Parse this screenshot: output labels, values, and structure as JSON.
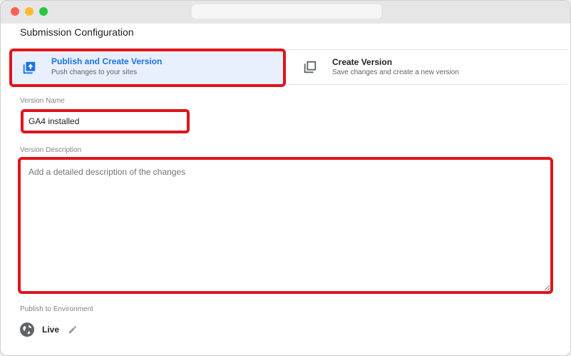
{
  "panel": {
    "title": "Submission Configuration"
  },
  "options": [
    {
      "title": "Publish and Create Version",
      "subtitle": "Push changes to your sites",
      "selected": true,
      "icon": "publish-icon"
    },
    {
      "title": "Create Version",
      "subtitle": "Save changes and create a new version",
      "selected": false,
      "icon": "copy-icon"
    }
  ],
  "version_name": {
    "label": "Version Name",
    "value": "GA4 installed"
  },
  "version_description": {
    "label": "Version Description",
    "placeholder": "Add a detailed description of the changes",
    "value": ""
  },
  "environment": {
    "label": "Publish to Environment",
    "name": "Live",
    "icon": "globe-icon",
    "edit_icon": "pencil-icon"
  },
  "colors": {
    "accent": "#1a73e8",
    "highlight": "#e0141b",
    "selected_bg": "#e8f0fe"
  }
}
